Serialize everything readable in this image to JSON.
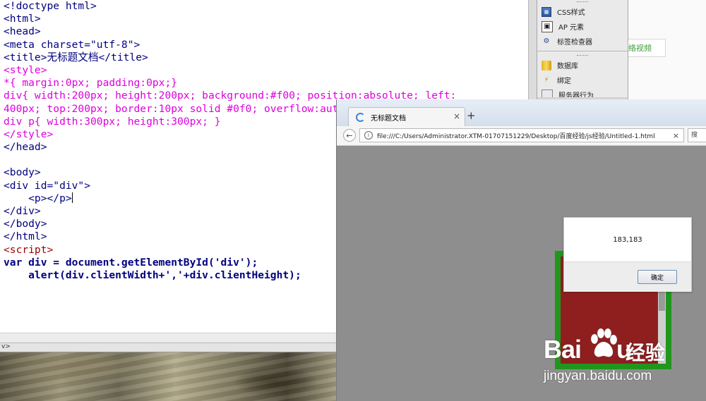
{
  "editor": {
    "lines": [
      "<!doctype html>",
      "<html>",
      "<head>",
      "<meta charset=\"utf-8\">",
      "<title>无标题文档</title>",
      "<style>",
      "*{ margin:0px; padding:0px;}",
      "div{ width:200px; height:200px; background:#f00; position:absolute; left:",
      "400px; top:200px; border:10px solid #0f0; overflow:auto; }",
      "div p{ width:300px; height:300px; }",
      "</style>",
      "</head>",
      "",
      "<body>",
      "<div id=\"div\">",
      "    <p></p>",
      "</div>",
      "</body>",
      "</html>",
      "<script>",
      "var div = document.getElementById('div');",
      "    alert(div.clientWidth+','+div.clientHeight);"
    ],
    "status_text": "v>"
  },
  "panel": {
    "items": [
      {
        "label": "CSS样式",
        "icon": "css-styles-icon"
      },
      {
        "label": "AP 元素",
        "icon": "ap-elements-icon"
      },
      {
        "label": "标签检查器",
        "icon": "tag-inspector-icon"
      },
      {
        "label": "数据库",
        "icon": "database-icon"
      },
      {
        "label": "绑定",
        "icon": "bindings-icon"
      },
      {
        "label": "服务器行为",
        "icon": "server-behaviors-icon"
      }
    ]
  },
  "background_link": "络视频",
  "browser": {
    "tab_title": "无标题文档",
    "tab_close": "×",
    "new_tab": "+",
    "url": "file:///C:/Users/Administrator.XTM-01707151229/Desktop/百度经验/js经验/Untitled-1.html",
    "url_clear": "×",
    "search_placeholder": "搜"
  },
  "alert": {
    "message": "183,183",
    "ok_label": "确定"
  },
  "watermark": {
    "brand": "Bai",
    "brand_end": "u",
    "cn": "经验",
    "domain": "jingyan.baidu.com"
  },
  "colors": {
    "border_green": "#21961d",
    "div_red": "#8f1f1f",
    "viewport_gray": "#8e8e8e"
  }
}
